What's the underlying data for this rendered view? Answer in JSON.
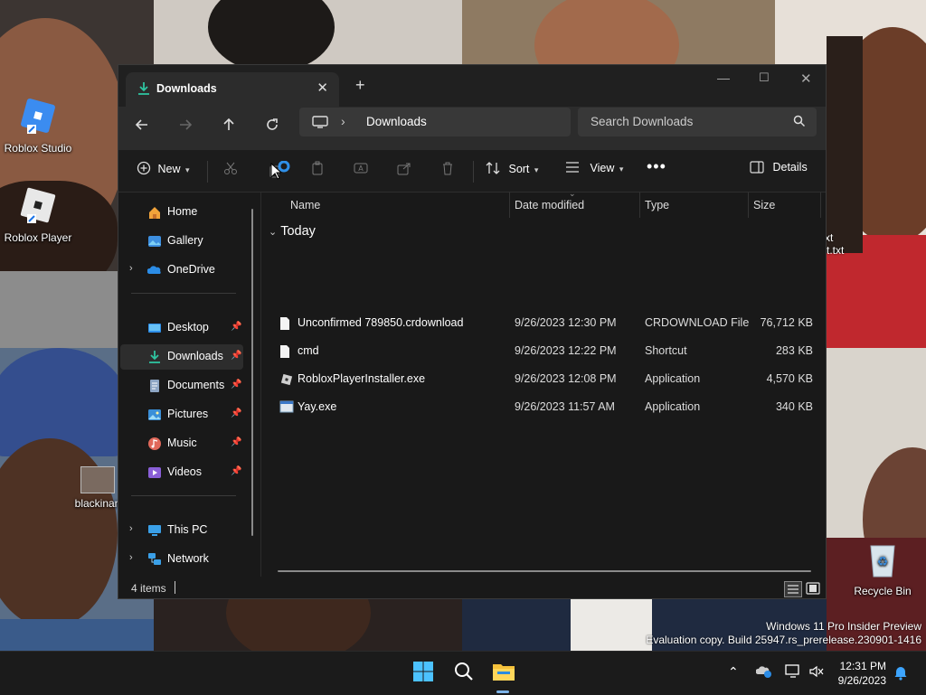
{
  "desktop": {
    "icons": [
      {
        "label": "Roblox Studio"
      },
      {
        "label": "Roblox Player"
      },
      {
        "label": "blackinan"
      },
      {
        "label": "Recycle Bin"
      }
    ],
    "partial_label_1": "xt",
    "partial_label_2": "t.txt",
    "watermark": {
      "line1": "Windows 11 Pro Insider Preview",
      "line2": "Evaluation copy. Build 25947.rs_prerelease.230901-1416"
    }
  },
  "window": {
    "tab_title": "Downloads",
    "address": {
      "crumb": "Downloads"
    },
    "search_placeholder": "Search Downloads",
    "commands": {
      "new": "New",
      "sort": "Sort",
      "view": "View",
      "details": "Details"
    },
    "nav": {
      "home": "Home",
      "gallery": "Gallery",
      "onedrive": "OneDrive",
      "desktop": "Desktop",
      "downloads": "Downloads",
      "documents": "Documents",
      "pictures": "Pictures",
      "music": "Music",
      "videos": "Videos",
      "thispc": "This PC",
      "network": "Network"
    },
    "columns": {
      "name": "Name",
      "date": "Date modified",
      "type": "Type",
      "size": "Size"
    },
    "group_label": "Today",
    "files": [
      {
        "name": "Unconfirmed 789850.crdownload",
        "date": "9/26/2023 12:30 PM",
        "type": "CRDOWNLOAD File",
        "size": "76,712 KB",
        "icon": "blank-file-icon"
      },
      {
        "name": "cmd",
        "date": "9/26/2023 12:22 PM",
        "type": "Shortcut",
        "size": "283 KB",
        "icon": "blank-file-icon"
      },
      {
        "name": "RobloxPlayerInstaller.exe",
        "date": "9/26/2023 12:08 PM",
        "type": "Application",
        "size": "4,570 KB",
        "icon": "roblox-installer-icon"
      },
      {
        "name": "Yay.exe",
        "date": "9/26/2023 11:57 AM",
        "type": "Application",
        "size": "340 KB",
        "icon": "exe-icon"
      }
    ],
    "status": {
      "count": "4 items"
    }
  },
  "taskbar": {
    "time": "12:31 PM",
    "date": "9/26/2023"
  }
}
